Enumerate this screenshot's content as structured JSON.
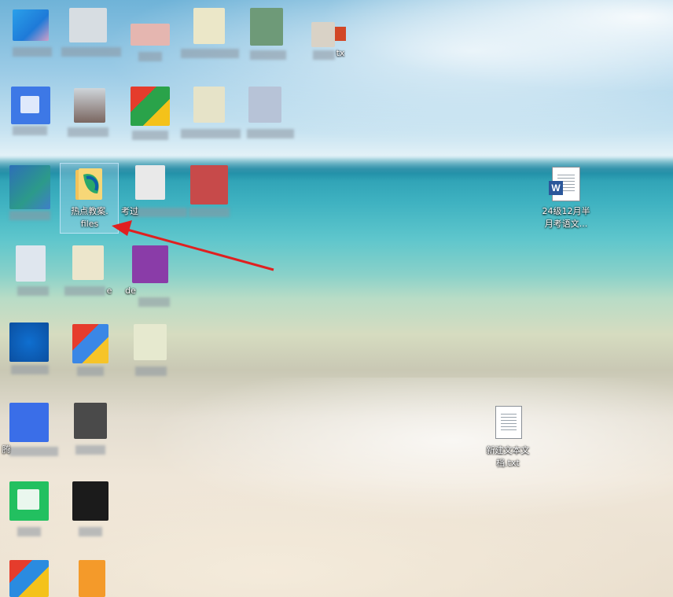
{
  "desktop": {
    "icons": [
      {
        "id": "hot-topics",
        "label_line1": "热点教案.",
        "label_line2": "files"
      },
      {
        "id": "word-doc",
        "label_line1": "24级12月半",
        "label_line2": "月考语文..."
      },
      {
        "id": "new-text",
        "label_line1": "新建文本文",
        "label_line2": "档.txt"
      }
    ],
    "partial_labels": {
      "ppt_suffix": "tx",
      "exam_prefix": "考过",
      "e_char": "e",
      "de_prefix": "de",
      "teng_char": "腾"
    },
    "word_badge": "W"
  },
  "colors": {
    "arrow": "#e02020",
    "selection_border": "#c8e6fa"
  }
}
